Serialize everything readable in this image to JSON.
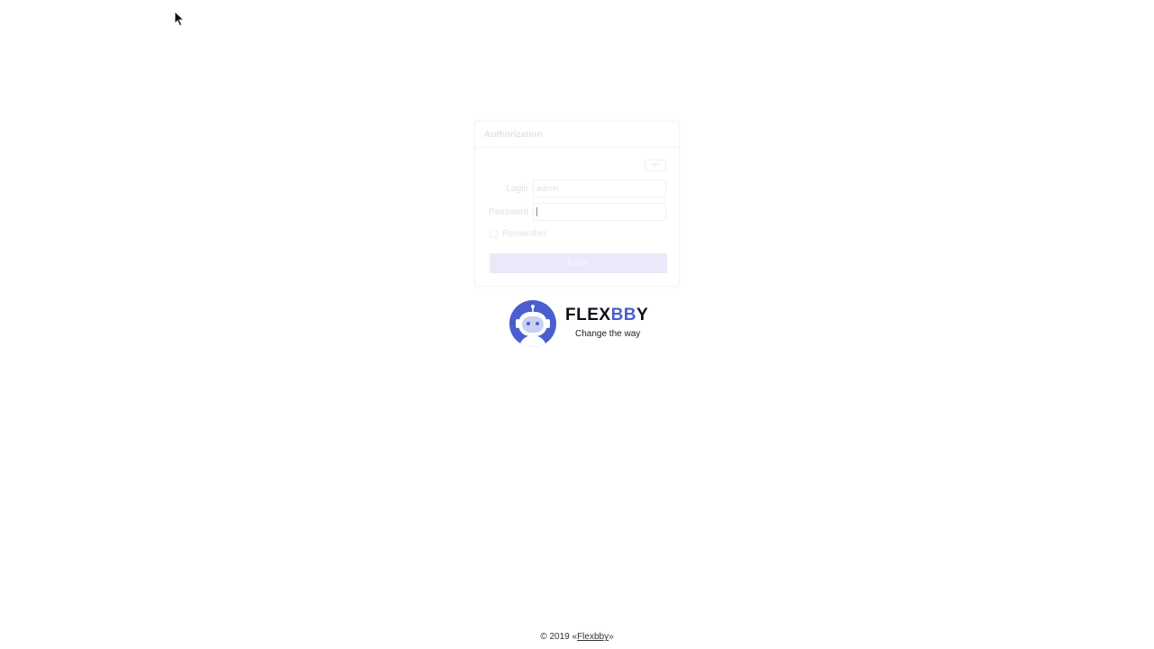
{
  "auth": {
    "title": "Authorization",
    "language": "en",
    "login_label": "Login",
    "login_value": "admin",
    "password_label": "Password",
    "password_value": "",
    "remember_label": "Remember",
    "enter_label": "Enter"
  },
  "brand": {
    "name_part1": "FLEX",
    "name_part2": "BB",
    "name_part3": "Y",
    "tagline": "Change the way",
    "accent_color": "#4a5ecf",
    "mark_icon": "robot-icon"
  },
  "footer": {
    "prefix": "© 2019 «",
    "link_text": "Flexbby",
    "suffix": "»"
  }
}
